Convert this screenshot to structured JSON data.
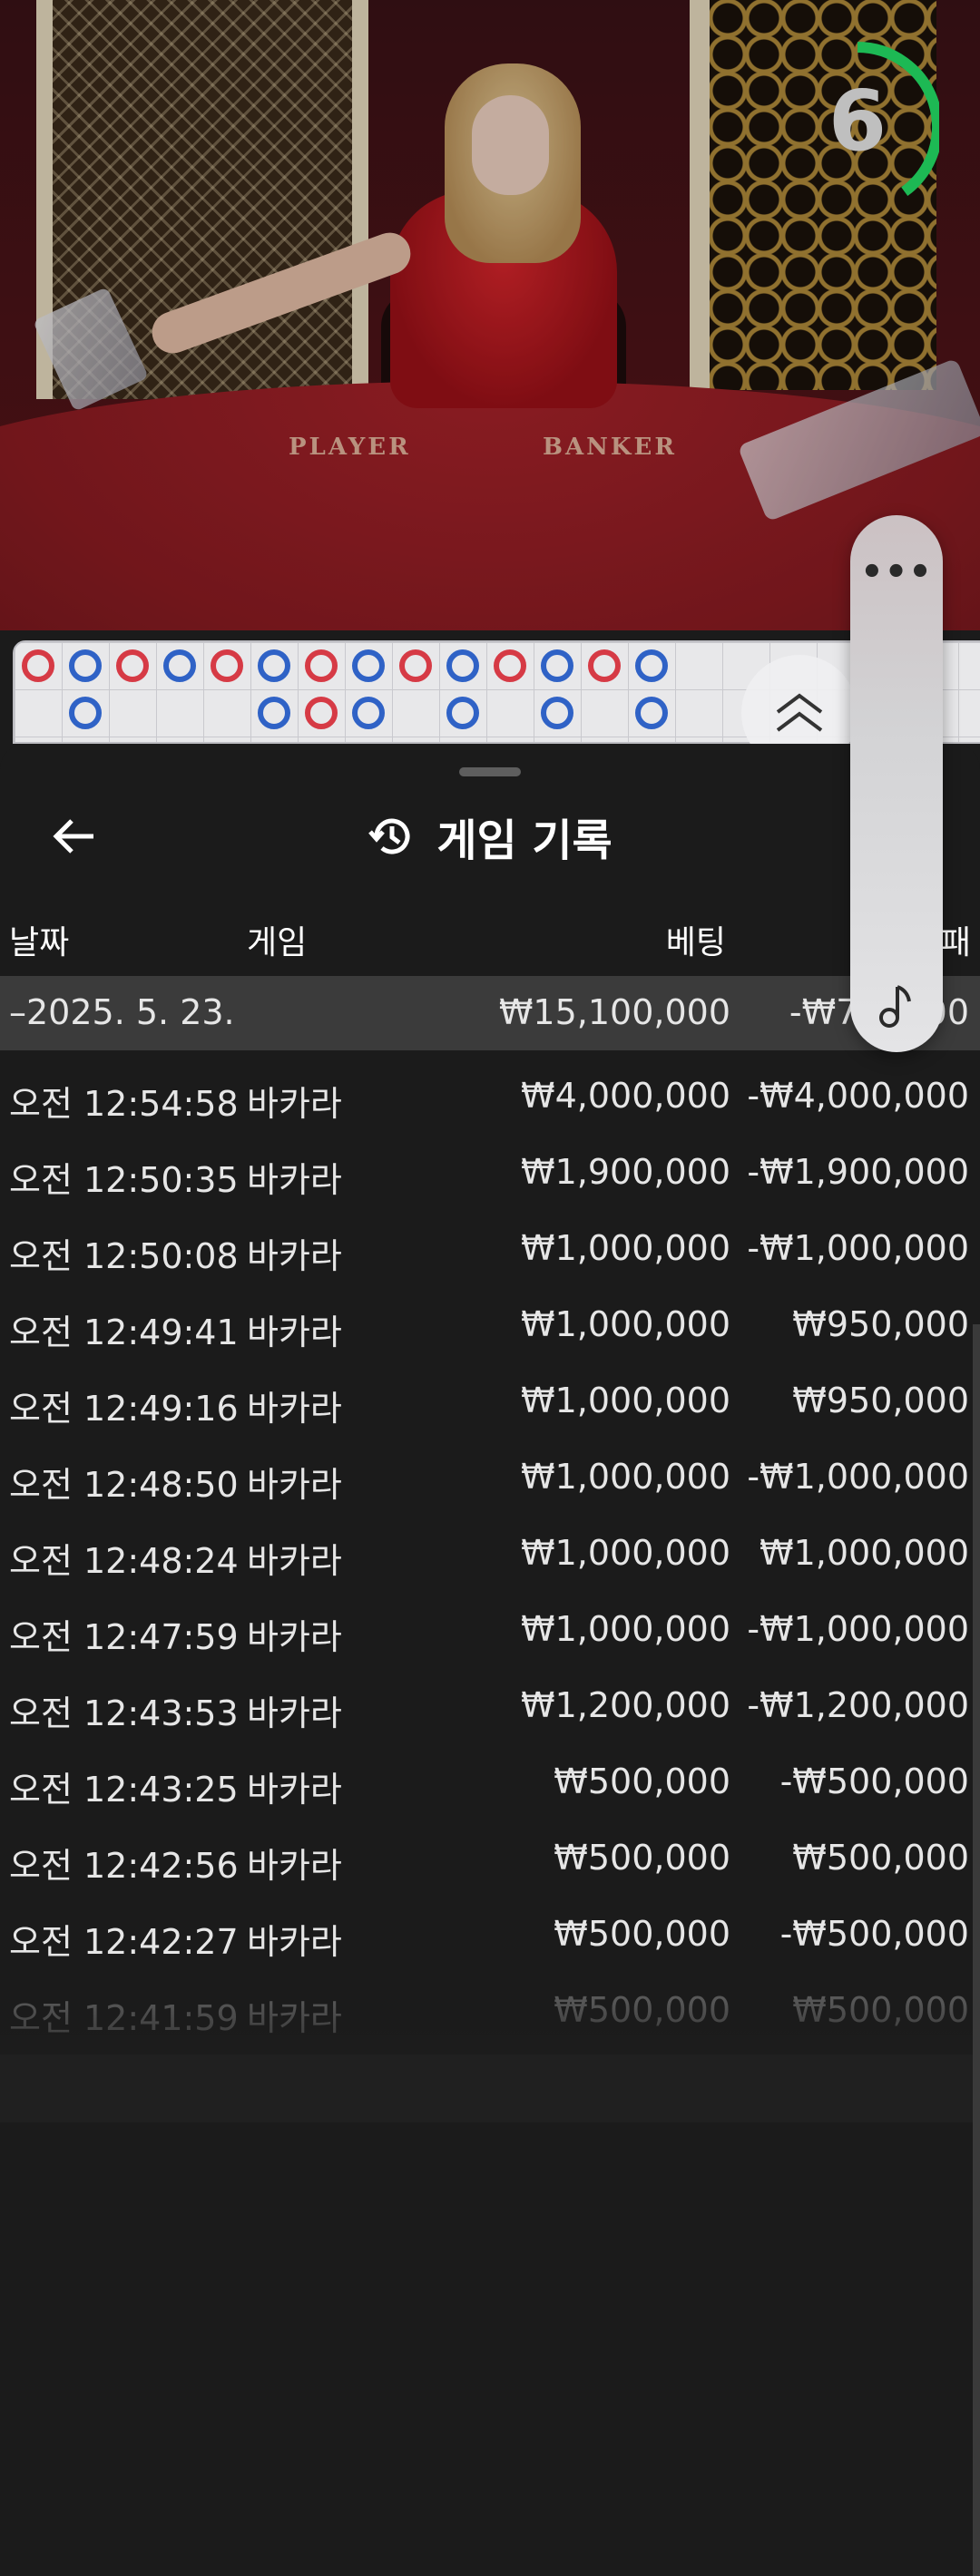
{
  "video": {
    "countdown": "6",
    "countdown_progress": 0.4,
    "table_labels": {
      "player": "PLAYER",
      "banker": "BANKER"
    }
  },
  "roadmap": {
    "beads": [
      {
        "col": 0,
        "row": 0,
        "c": "r"
      },
      {
        "col": 1,
        "row": 0,
        "c": "b"
      },
      {
        "col": 2,
        "row": 0,
        "c": "r"
      },
      {
        "col": 3,
        "row": 0,
        "c": "b"
      },
      {
        "col": 4,
        "row": 0,
        "c": "r"
      },
      {
        "col": 5,
        "row": 0,
        "c": "b"
      },
      {
        "col": 6,
        "row": 0,
        "c": "r"
      },
      {
        "col": 7,
        "row": 0,
        "c": "b"
      },
      {
        "col": 8,
        "row": 0,
        "c": "r"
      },
      {
        "col": 9,
        "row": 0,
        "c": "b"
      },
      {
        "col": 10,
        "row": 0,
        "c": "r"
      },
      {
        "col": 11,
        "row": 0,
        "c": "b"
      },
      {
        "col": 12,
        "row": 0,
        "c": "r"
      },
      {
        "col": 13,
        "row": 0,
        "c": "b"
      },
      {
        "col": 1,
        "row": 1,
        "c": "b"
      },
      {
        "col": 5,
        "row": 1,
        "c": "b"
      },
      {
        "col": 6,
        "row": 1,
        "c": "r"
      },
      {
        "col": 7,
        "row": 1,
        "c": "b"
      },
      {
        "col": 9,
        "row": 1,
        "c": "b"
      },
      {
        "col": 11,
        "row": 1,
        "c": "b"
      },
      {
        "col": 13,
        "row": 1,
        "c": "b"
      }
    ]
  },
  "history": {
    "title": "게임 기록",
    "headers": {
      "date": "날짜",
      "game": "게임",
      "bet": "베팅",
      "result": "승/패"
    },
    "summary": {
      "date": "–2025. 5. 23.",
      "bet": "₩15,100,000",
      "result": "-₩7,2…00"
    },
    "rows": [
      {
        "time": "오전 12:54:58",
        "game": "바카라",
        "bet": "₩4,000,000",
        "result": "-₩4,000,000"
      },
      {
        "time": "오전 12:50:35",
        "game": "바카라",
        "bet": "₩1,900,000",
        "result": "-₩1,900,000"
      },
      {
        "time": "오전 12:50:08",
        "game": "바카라",
        "bet": "₩1,000,000",
        "result": "-₩1,000,000"
      },
      {
        "time": "오전 12:49:41",
        "game": "바카라",
        "bet": "₩1,000,000",
        "result": "₩950,000"
      },
      {
        "time": "오전 12:49:16",
        "game": "바카라",
        "bet": "₩1,000,000",
        "result": "₩950,000"
      },
      {
        "time": "오전 12:48:50",
        "game": "바카라",
        "bet": "₩1,000,000",
        "result": "-₩1,000,000"
      },
      {
        "time": "오전 12:48:24",
        "game": "바카라",
        "bet": "₩1,000,000",
        "result": "₩1,000,000"
      },
      {
        "time": "오전 12:47:59",
        "game": "바카라",
        "bet": "₩1,000,000",
        "result": "-₩1,000,000"
      },
      {
        "time": "오전 12:43:53",
        "game": "바카라",
        "bet": "₩1,200,000",
        "result": "-₩1,200,000"
      },
      {
        "time": "오전 12:43:25",
        "game": "바카라",
        "bet": "₩500,000",
        "result": "-₩500,000"
      },
      {
        "time": "오전 12:42:56",
        "game": "바카라",
        "bet": "₩500,000",
        "result": "₩500,000"
      },
      {
        "time": "오전 12:42:27",
        "game": "바카라",
        "bet": "₩500,000",
        "result": "-₩500,000"
      },
      {
        "time": "오전 12:41:59",
        "game": "바카라",
        "bet": "₩500,000",
        "result": "₩500,000"
      }
    ]
  },
  "side_menu": {
    "more_label": "•••",
    "icons": [
      "more-icon",
      "music-note-icon"
    ]
  },
  "colors": {
    "accent_green": "#1db954",
    "player_blue": "#2f62c6",
    "banker_red": "#d63a45",
    "sheet_bg": "#1b1b1b"
  }
}
